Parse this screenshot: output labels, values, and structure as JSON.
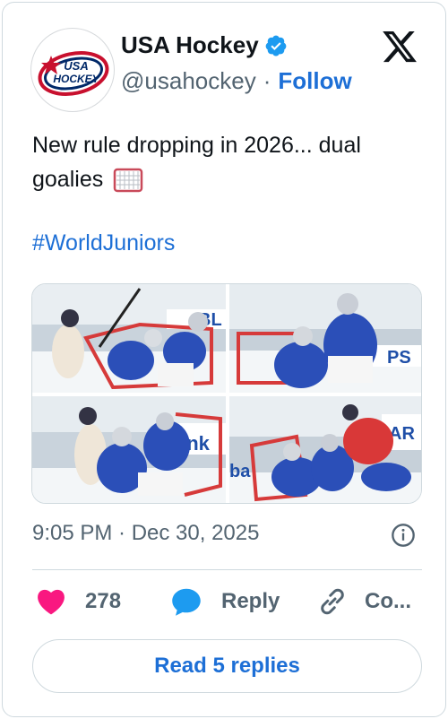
{
  "author": {
    "display_name": "USA Hockey",
    "handle": "@usahockey",
    "separator": "·",
    "follow_label": "Follow",
    "logo_text_top": "USA",
    "logo_text_bottom": "HOCKEY"
  },
  "tweet": {
    "text": "New rule dropping in 2026... dual goalies",
    "hashtag": "#WorldJuniors",
    "timestamp": "9:05 PM · Dec 30, 2025"
  },
  "media": {
    "photos": [
      {
        "banner": "BL"
      },
      {
        "banner": "PS"
      },
      {
        "banner": "ank"
      },
      {
        "banner": "AR"
      }
    ]
  },
  "actions": {
    "like_count": "278",
    "reply_label": "Reply",
    "copy_label": "Co..."
  },
  "read_replies_label": "Read 5 replies",
  "colors": {
    "brand_blue": "#1d6fd6",
    "like_pink": "#f91880",
    "muted": "#536471",
    "border": "#cfd9de",
    "jersey_blue": "#2b4fb8",
    "jersey_red": "#d93838"
  },
  "icons": [
    "verified-badge-icon",
    "x-logo-icon",
    "hockey-goal-icon",
    "info-icon",
    "heart-icon",
    "reply-bubble-icon",
    "link-icon"
  ]
}
